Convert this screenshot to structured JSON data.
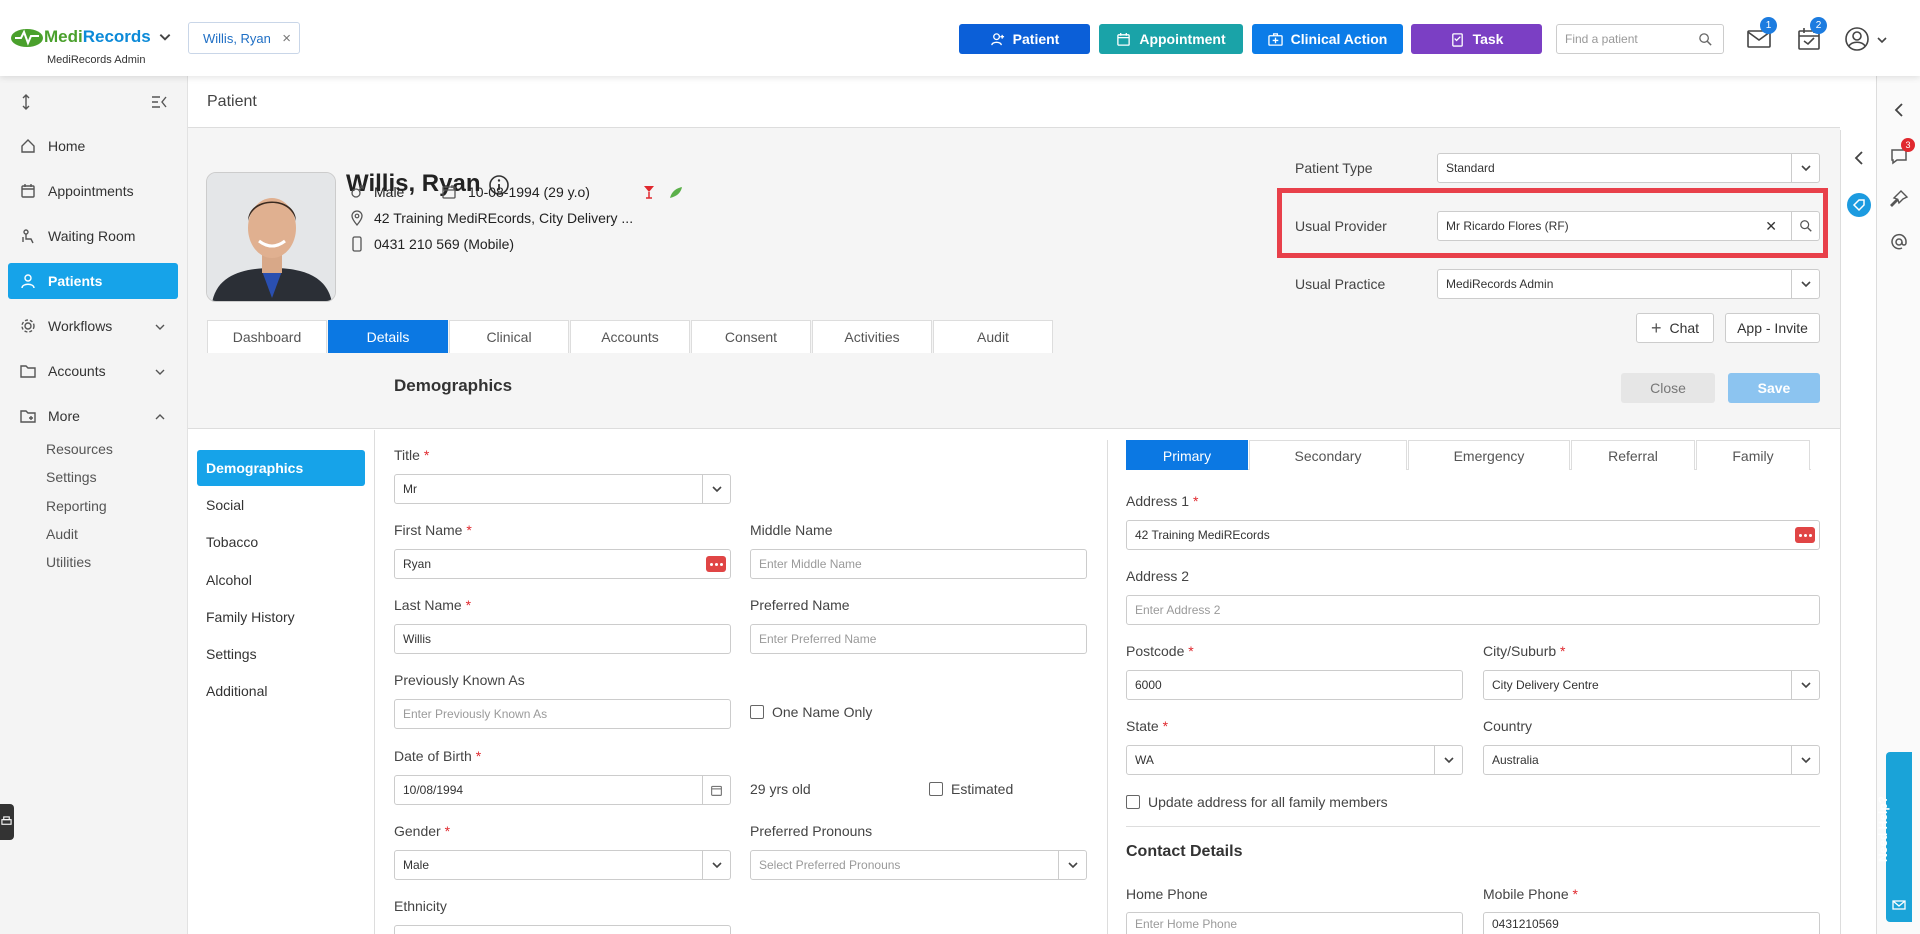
{
  "app": {
    "logo_main": "Medi",
    "logo_accent": "Records",
    "logo_sub": "MediRecords Admin"
  },
  "patient_tab": {
    "label": "Willis, Ryan",
    "close": "×"
  },
  "topbar": {
    "buttons": [
      {
        "label": "Patient",
        "color": "#0b5fd8"
      },
      {
        "label": "Appointment",
        "color": "#1aa3a8"
      },
      {
        "label": "Clinical Action",
        "color": "#0b7ce8"
      },
      {
        "label": "Task",
        "color": "#7b3fc4"
      }
    ],
    "search_placeholder": "Find a patient",
    "mail_badge": "1",
    "tasks_badge": "2"
  },
  "sidebar": {
    "items": [
      {
        "label": "Home"
      },
      {
        "label": "Appointments"
      },
      {
        "label": "Waiting Room"
      },
      {
        "label": "Patients"
      },
      {
        "label": "Workflows"
      },
      {
        "label": "Accounts"
      },
      {
        "label": "More"
      }
    ],
    "more_sub": [
      "Resources",
      "Settings",
      "Reporting",
      "Audit",
      "Utilities"
    ]
  },
  "page": {
    "title": "Patient"
  },
  "patient": {
    "name": "Willis, Ryan",
    "gender": "Male",
    "dob": "10-08-1994 (29 y.o)",
    "address": "42 Training MediREcords, City Delivery ...",
    "phone": "0431 210 569 (Mobile)"
  },
  "header_fields": {
    "patient_type_label": "Patient Type",
    "patient_type": "Standard",
    "usual_provider_label": "Usual Provider",
    "usual_provider": "Mr Ricardo Flores (RF)",
    "usual_practice_label": "Usual Practice",
    "usual_practice": "MediRecords Admin",
    "chat": "Chat",
    "app_invite": "App - Invite"
  },
  "tabs": [
    "Dashboard",
    "Details",
    "Clinical",
    "Accounts",
    "Consent",
    "Activities",
    "Audit"
  ],
  "left_nav": [
    "Demographics",
    "Social",
    "Tobacco",
    "Alcohol",
    "Family History",
    "Settings",
    "Additional"
  ],
  "form": {
    "section_title": "Demographics",
    "close": "Close",
    "save": "Save",
    "title_label": "Title",
    "title_value": "Mr",
    "first_name_label": "First Name",
    "first_name": "Ryan",
    "middle_name_label": "Middle Name",
    "middle_name_ph": "Enter Middle Name",
    "last_name_label": "Last Name",
    "last_name": "Willis",
    "preferred_name_label": "Preferred Name",
    "preferred_name_ph": "Enter Preferred Name",
    "prev_known_label": "Previously Known As",
    "prev_known_ph": "Enter Previously Known As",
    "one_name_only": "One Name Only",
    "dob_label": "Date of Birth",
    "dob_value": "10/08/1994",
    "age": "29 yrs old",
    "estimated": "Estimated",
    "gender_label": "Gender",
    "gender_value": "Male",
    "pronouns_label": "Preferred Pronouns",
    "pronouns_ph": "Select Preferred Pronouns",
    "ethnicity_label": "Ethnicity",
    "required_mark": "*"
  },
  "address": {
    "tabs": [
      "Primary",
      "Secondary",
      "Emergency",
      "Referral",
      "Family"
    ],
    "address1_label": "Address 1",
    "address1": "42 Training MediREcords",
    "address2_label": "Address 2",
    "address2_ph": "Enter Address 2",
    "postcode_label": "Postcode",
    "postcode": "6000",
    "city_label": "City/Suburb",
    "city": "City Delivery Centre",
    "state_label": "State",
    "state": "WA",
    "country_label": "Country",
    "country": "Australia",
    "update_all": "Update address for all family members",
    "contact_title": "Contact Details",
    "home_phone_label": "Home Phone",
    "home_phone_ph": "Enter Home Phone",
    "mobile_label": "Mobile Phone",
    "mobile": "0431210569"
  },
  "rail": {
    "chat_badge": "3",
    "help": "Need Help?"
  }
}
